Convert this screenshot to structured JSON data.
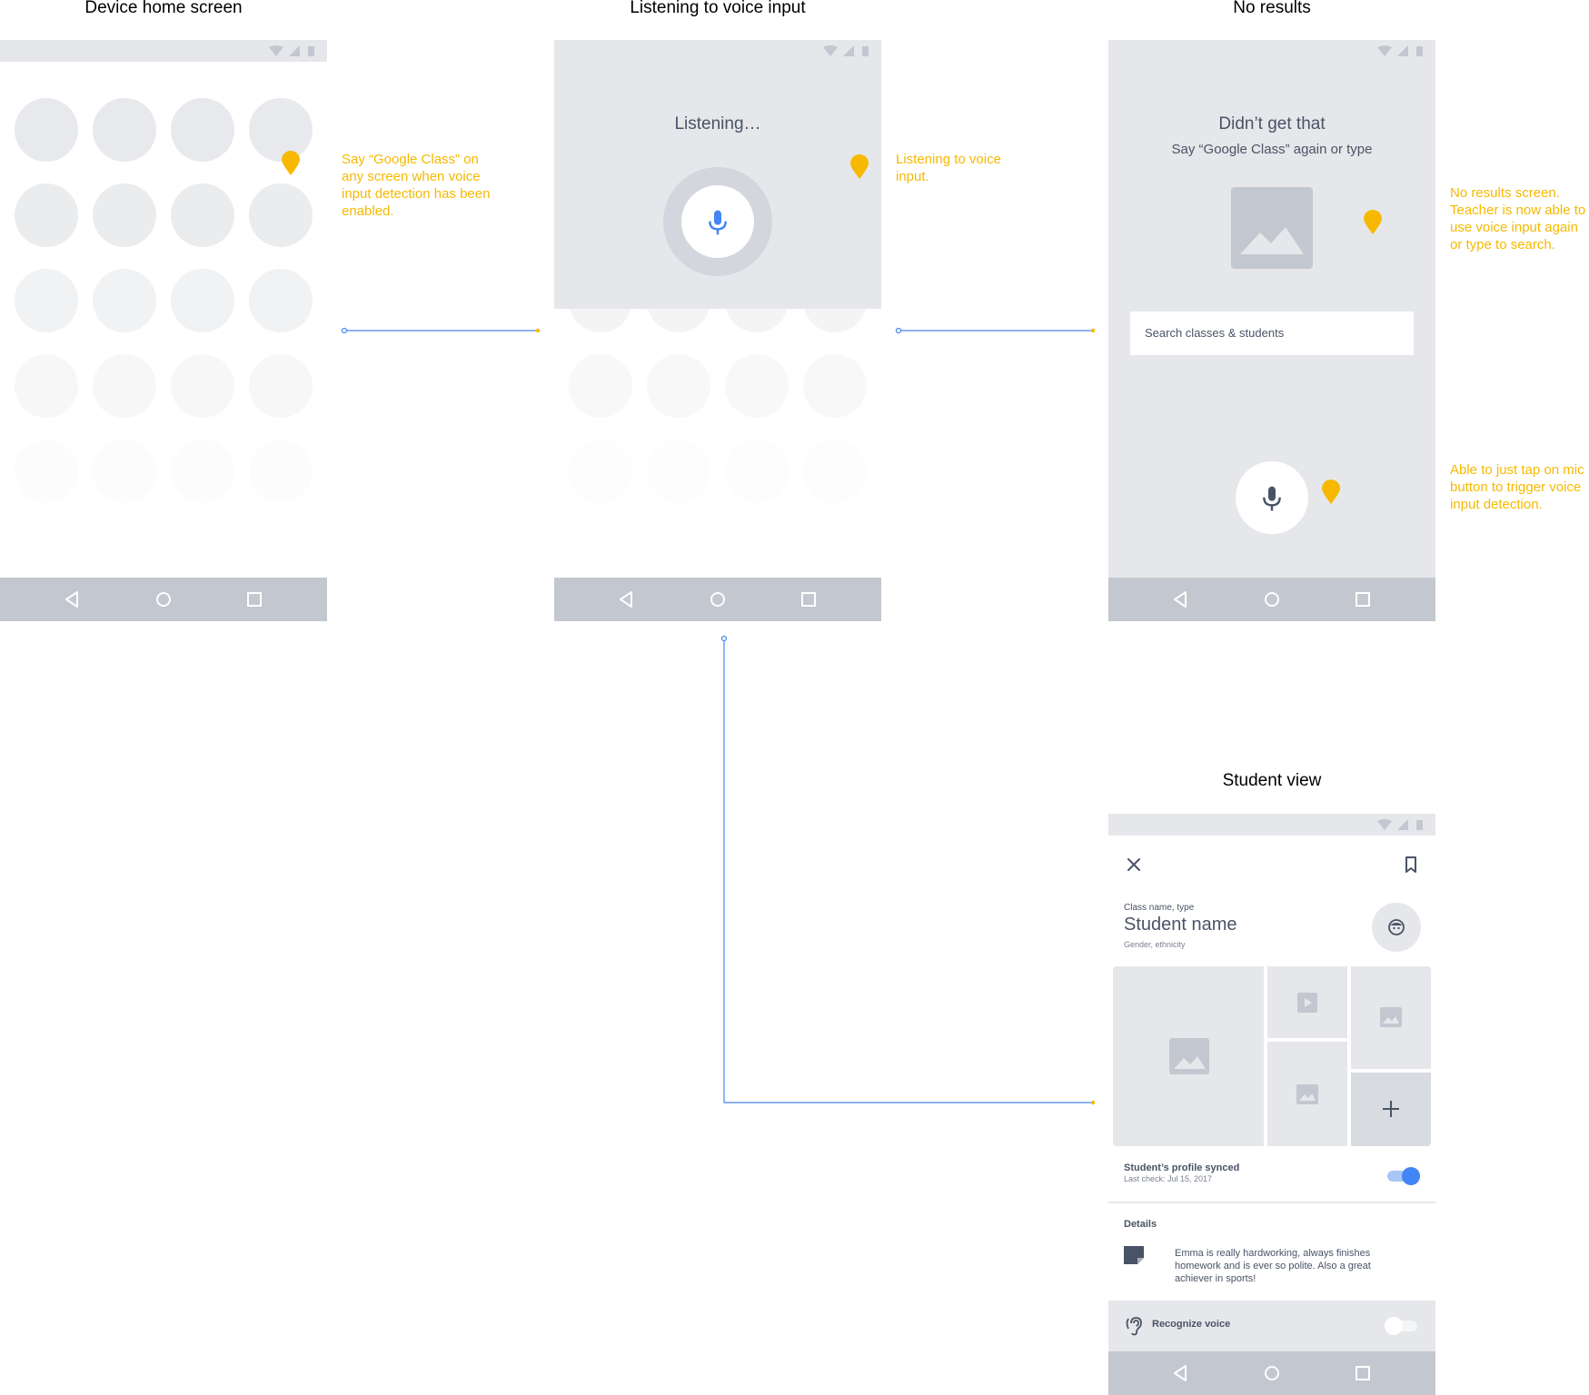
{
  "screens": {
    "home": {
      "title": "Device home screen"
    },
    "listening": {
      "title": "Listening to voice input",
      "status_text": "Listening…"
    },
    "no_results": {
      "title": "No results",
      "heading": "Didn’t get that",
      "subheading": "Say “Google Class” again or type",
      "search_placeholder": "Search classes & students"
    },
    "student": {
      "title": "Student view",
      "class_label": "Class name, type",
      "student_name": "Student name",
      "meta": "Gender, ethnicity",
      "sync_title": "Student’s profile synced",
      "sync_subtitle": "Last check: Jul 15, 2017",
      "sync_enabled": true,
      "details_label": "Details",
      "details_text": "Emma is really hardworking, always finishes homework and is ever so polite. Also a great achiever in sports!",
      "recognize_label": "Recognize voice",
      "recognize_enabled": false
    }
  },
  "annotations": {
    "home": "Say “Google Class” on any screen when voice input detection has been enabled.",
    "listening": "Listening to voice input.",
    "no_results": "No results screen. Teacher is now able to use voice input again or type to search.",
    "mic": "Able to just tap on mic button to trigger voice input detection."
  },
  "colors": {
    "annotation": "#f6b900",
    "connector": "#4a86e8",
    "mic_accent": "#4285f4",
    "placeholder": "#e6e7ea",
    "navbar": "#c3c7cf",
    "dark_icon": "#4a5366"
  },
  "icons": [
    "wifi-icon",
    "signal-icon",
    "battery-icon",
    "back-icon",
    "home-icon",
    "recents-icon",
    "mic-icon",
    "image-icon",
    "close-icon",
    "bookmark-icon",
    "avatar-icon",
    "play-icon",
    "add-icon",
    "note-icon",
    "ear-icon",
    "pin-icon"
  ]
}
